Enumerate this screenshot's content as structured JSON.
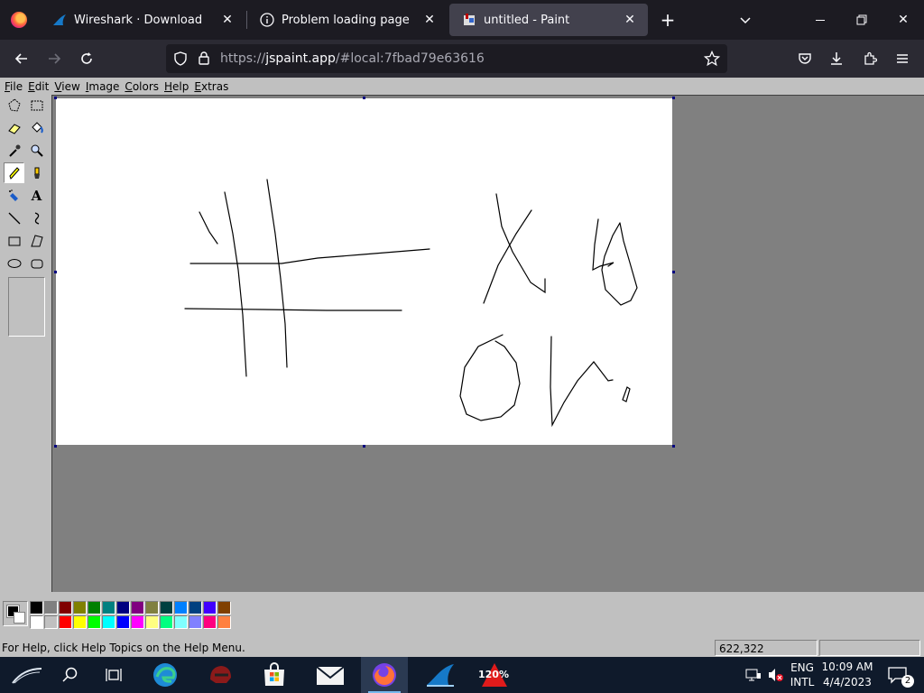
{
  "browser": {
    "tabs": [
      {
        "label": "Wireshark · Download",
        "icon": "wireshark-fin-icon"
      },
      {
        "label": "Problem loading page",
        "icon": "info-icon"
      },
      {
        "label": "untitled - Paint",
        "icon": "paint-icon",
        "active": true
      }
    ],
    "url": {
      "prefix": "https://",
      "host": "jspaint.app",
      "rest": "/#local:7fbad79e63616"
    }
  },
  "paint": {
    "menu": [
      "File",
      "Edit",
      "View",
      "Image",
      "Colors",
      "Help",
      "Extras"
    ],
    "tools": [
      "free-form-select",
      "select",
      "eraser",
      "fill-with-color",
      "pick-color",
      "magnifier",
      "pencil",
      "brush",
      "airbrush",
      "text",
      "line",
      "curve",
      "rectangle",
      "polygon",
      "ellipse",
      "rounded-rectangle"
    ],
    "selected_tool": "pencil",
    "palette_top": [
      "#000000",
      "#808080",
      "#800000",
      "#808000",
      "#008000",
      "#008080",
      "#000080",
      "#800080",
      "#808040",
      "#004040",
      "#0080ff",
      "#004080",
      "#4000ff",
      "#804000"
    ],
    "palette_bottom": [
      "#ffffff",
      "#c0c0c0",
      "#ff0000",
      "#ffff00",
      "#00ff00",
      "#00ffff",
      "#0000ff",
      "#ff00ff",
      "#ffff80",
      "#00ff80",
      "#80ffff",
      "#8080ff",
      "#ff0080",
      "#ff8040"
    ],
    "foreground": "#000000",
    "background": "#ffffff",
    "status": {
      "help": "For Help, click Help Topics on the Help Menu.",
      "coords": "622,322"
    }
  },
  "taskbar": {
    "apps": [
      "edge",
      "game",
      "store",
      "mail",
      "firefox",
      "wireshark",
      "zoom-120"
    ],
    "zoom_label": "120%",
    "lang_top": "ENG",
    "lang_bottom": "INTL",
    "time": "10:09 AM",
    "date": "4/4/2023",
    "notifications": "2"
  }
}
